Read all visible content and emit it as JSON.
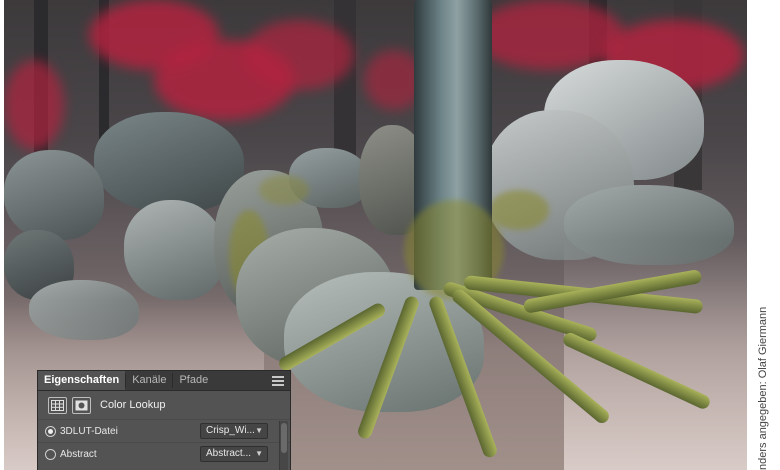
{
  "panel": {
    "tabs": [
      {
        "label": "Eigenschaften",
        "active": true
      },
      {
        "label": "Kanäle",
        "active": false
      },
      {
        "label": "Pfade",
        "active": false
      }
    ],
    "title": "Color Lookup",
    "rows": [
      {
        "label": "3DLUT-Datei",
        "selected": true,
        "value": "Crisp_Wi..."
      },
      {
        "label": "Abstract",
        "selected": false,
        "value": "Abstract..."
      }
    ]
  },
  "credit": "nders angegeben: Olaf Giermann",
  "colors": {
    "panel_bg": "#535353",
    "tab_bar": "#3a3a3a",
    "foliage": "#b2233f"
  }
}
